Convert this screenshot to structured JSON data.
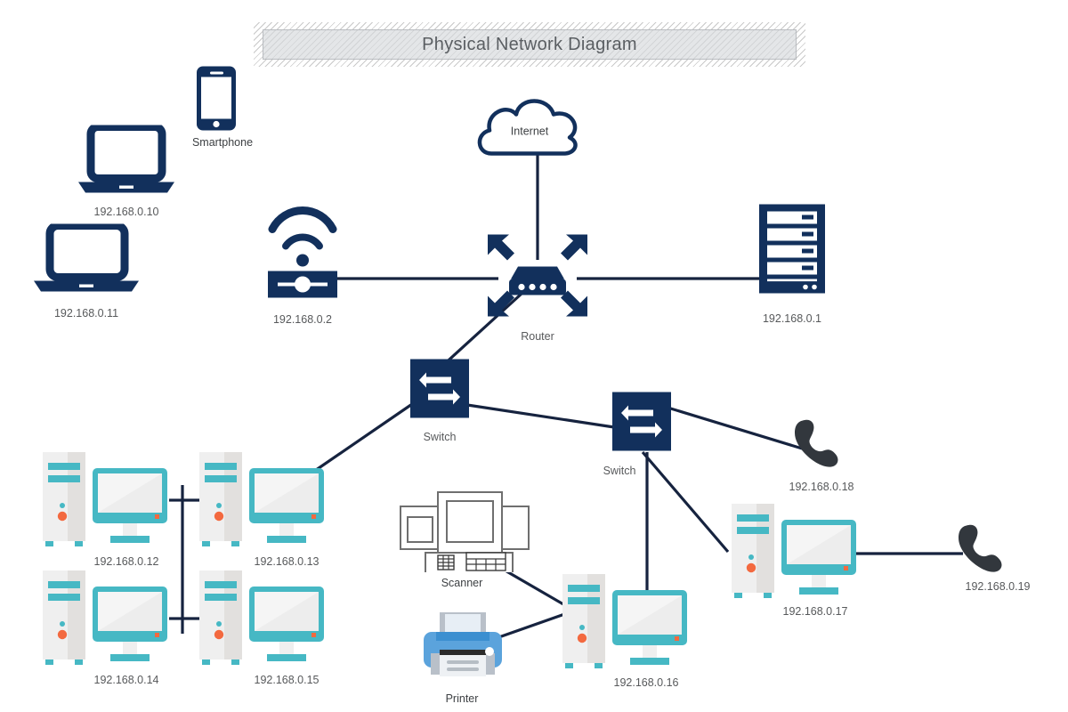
{
  "title": "Physical Network Diagram",
  "colors": {
    "navy": "#12305c",
    "navy_dark": "#0f2b52",
    "line": "#16233f",
    "teal": "#46b8c4",
    "teal_dark": "#3aa7b3",
    "tower_light": "#efefef",
    "tower_shade": "#e2e0de",
    "screen": "#ededed",
    "screen_hi": "#f7f7f7",
    "orange": "#f3693f",
    "blue_printer": "#5ba3dc",
    "blue_printer_dark": "#3c8fd0",
    "phone_dark": "#32373d",
    "label_gray": "#57595b",
    "banner_bg": "#e4e6e8"
  },
  "nodes": {
    "laptop_10": {
      "label": "192.168.0.10",
      "kind": "laptop"
    },
    "laptop_11": {
      "label": "192.168.0.11",
      "kind": "laptop"
    },
    "smartphone": {
      "label": "Smartphone",
      "kind": "smartphone"
    },
    "wap": {
      "label": "192.168.0.2",
      "kind": "wireless-access-point"
    },
    "internet": {
      "label": "Internet",
      "kind": "cloud"
    },
    "router": {
      "label": "Router",
      "kind": "router"
    },
    "server": {
      "label": "192.168.0.1",
      "kind": "server"
    },
    "switch_1": {
      "label": "Switch",
      "kind": "switch"
    },
    "switch_2": {
      "label": "Switch",
      "kind": "switch"
    },
    "ws_12": {
      "label": "192.168.0.12",
      "kind": "workstation"
    },
    "ws_13": {
      "label": "192.168.0.13",
      "kind": "workstation"
    },
    "ws_14": {
      "label": "192.168.0.14",
      "kind": "workstation"
    },
    "ws_15": {
      "label": "192.168.0.15",
      "kind": "workstation"
    },
    "ws_16": {
      "label": "192.168.0.16",
      "kind": "workstation"
    },
    "ws_17": {
      "label": "192.168.0.17",
      "kind": "workstation"
    },
    "scanner": {
      "label": "Scanner",
      "kind": "scanner"
    },
    "printer": {
      "label": "Printer",
      "kind": "printer"
    },
    "phone_18": {
      "label": "192.168.0.18",
      "kind": "ip-phone"
    },
    "phone_19": {
      "label": "192.168.0.19",
      "kind": "ip-phone"
    }
  }
}
